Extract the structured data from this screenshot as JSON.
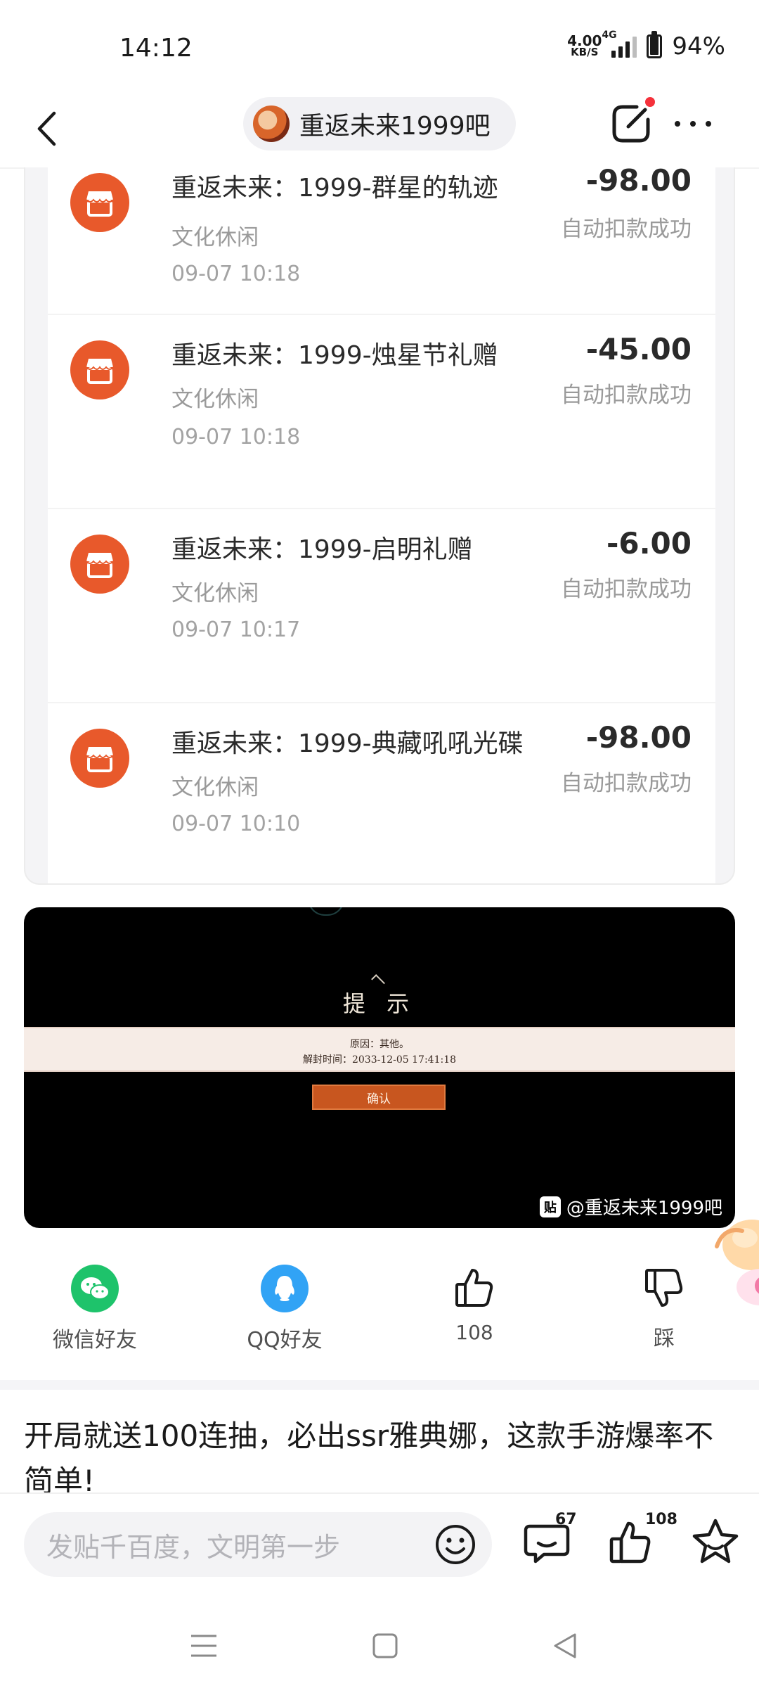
{
  "status_bar": {
    "time": "14:12",
    "net_speed_value": "4.00",
    "net_speed_unit": "KB/S",
    "network_type": "4G",
    "battery_percent": "94%",
    "battery_level": 0.94
  },
  "header": {
    "forum_name": "重返未来1999吧",
    "back_icon": "chevron-left-icon",
    "edit_icon": "edit-icon",
    "more_icon": "more-dots-icon"
  },
  "transactions": [
    {
      "title": "重返未来：1999-群星的轨迹",
      "category": "文化休闲",
      "time": "09-07 10:18",
      "amount": "-98.00",
      "status": "自动扣款成功"
    },
    {
      "title": "重返未来：1999-烛星节礼赠",
      "category": "文化休闲",
      "time": "09-07 10:18",
      "amount": "-45.00",
      "status": "自动扣款成功"
    },
    {
      "title": "重返未来：1999-启明礼赠",
      "category": "文化休闲",
      "time": "09-07 10:17",
      "amount": "-6.00",
      "status": "自动扣款成功"
    },
    {
      "title": "重返未来：1999-典藏吼吼光碟",
      "category": "文化休闲",
      "time": "09-07 10:10",
      "amount": "-98.00",
      "status": "自动扣款成功"
    }
  ],
  "game_dialog": {
    "title": "提 示",
    "reason": "原因：其他。",
    "unban_time": "解封时间：2033-12-05 17:41:18",
    "confirm_label": "确认",
    "watermark": "@重返未来1999吧",
    "watermark_logo": "贴"
  },
  "share": {
    "wechat_label": "微信好友",
    "qq_label": "QQ好友",
    "like_count": "108",
    "dislike_label": "踩"
  },
  "recommended": {
    "title": "开局就送100连抽，必出ssr雅典娜，这款手游爆率不简单!"
  },
  "bottom_bar": {
    "input_placeholder": "发贴千百度，文明第一步",
    "comment_count": "67",
    "like_count": "108"
  },
  "colors": {
    "accent_orange": "#e8592b",
    "wechat_green": "#1ec36b",
    "qq_blue": "#31a3f5",
    "notification_red": "#f5313b"
  }
}
